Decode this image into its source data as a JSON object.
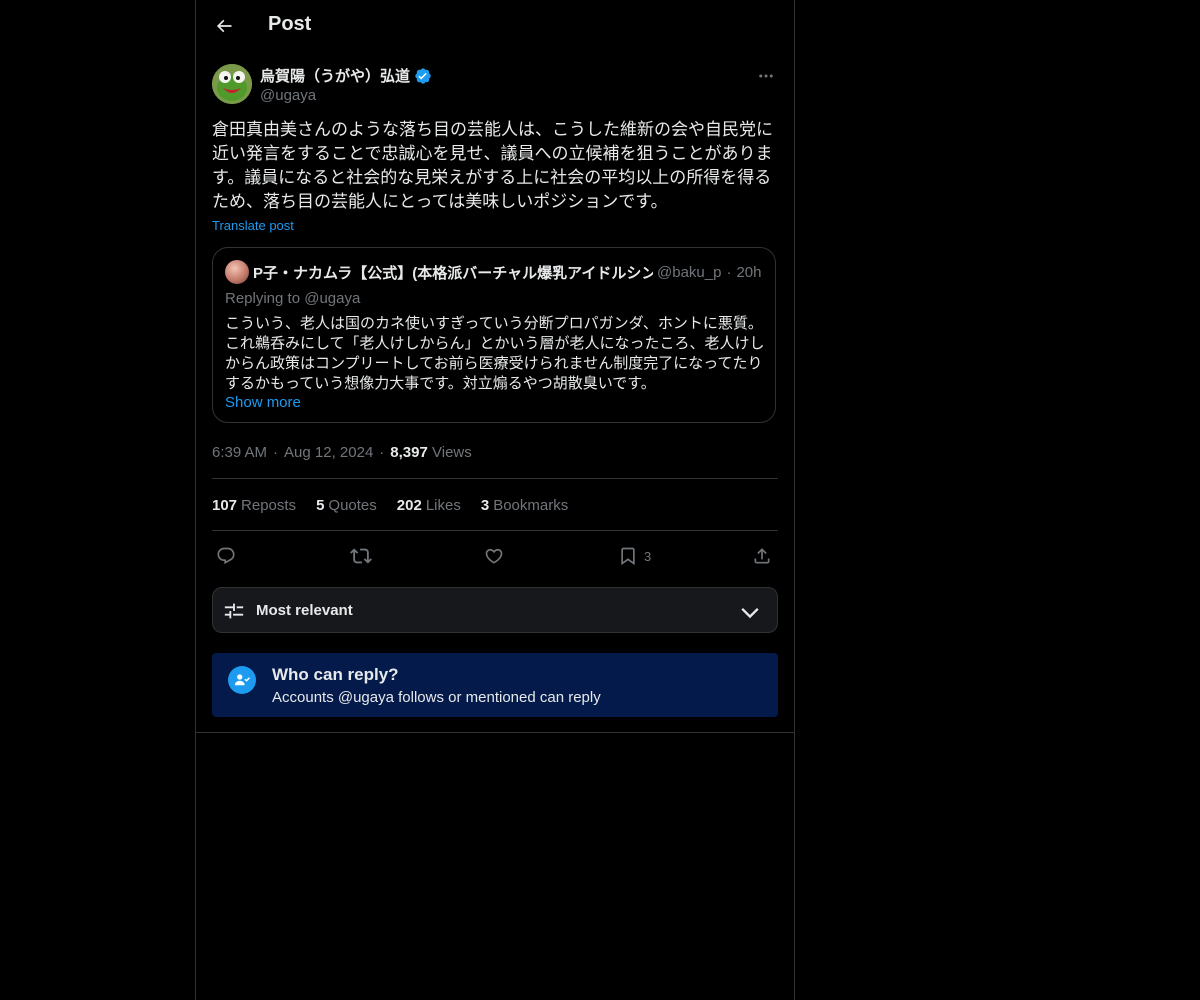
{
  "header": {
    "title": "Post"
  },
  "post": {
    "author_name": "烏賀陽（うがや）弘道",
    "author_handle": "@ugaya",
    "text": "倉田真由美さんのような落ち目の芸能人は、こうした維新の会や自民党に近い発言をすることで忠誠心を見せ、議員への立候補を狙うことがあります。議員になると社会的な見栄えがする上に社会の平均以上の所得を得るため、落ち目の芸能人にとっては美味しいポジションです。",
    "translate_label": "Translate post",
    "time": "6:39 AM",
    "date": "Aug 12, 2024",
    "views_count": "8,397",
    "views_label": "Views"
  },
  "quote": {
    "name": "P子・ナカムラ【公式】(本格派バーチャル爆乳アイドルシン",
    "handle": "@baku_p",
    "dot": "·",
    "time": "20h",
    "replying": "Replying to @ugaya",
    "text": "こういう、老人は国のカネ使いすぎっていう分断プロパガンダ、ホントに悪質。これ鵜呑みにして「老人けしからん」とかいう層が老人になったころ、老人けしからん政策はコンプリートしてお前ら医療受けられません制度完了になってたりするかもっていう想像力大事です。対立煽るやつ胡散臭いです。",
    "show_more": "Show more"
  },
  "stats": {
    "reposts_count": "107",
    "reposts_label": "Reposts",
    "quotes_count": "5",
    "quotes_label": "Quotes",
    "likes_count": "202",
    "likes_label": "Likes",
    "bookmarks_count": "3",
    "bookmarks_label": "Bookmarks"
  },
  "actions": {
    "bookmark_count": "3",
    "icons": [
      "reply-icon",
      "repost-icon",
      "like-icon",
      "bookmark-icon",
      "share-icon"
    ]
  },
  "sort": {
    "label": "Most relevant"
  },
  "who_can_reply": {
    "title": "Who can reply?",
    "description": "Accounts @ugaya follows or mentioned can reply"
  },
  "meta_separator": "·",
  "colors": {
    "background": "#000000",
    "text": "#e7e9ea",
    "muted": "#71767b",
    "accent": "#1d9bf0",
    "border": "#2f3336",
    "info_box": "#031a4a"
  }
}
